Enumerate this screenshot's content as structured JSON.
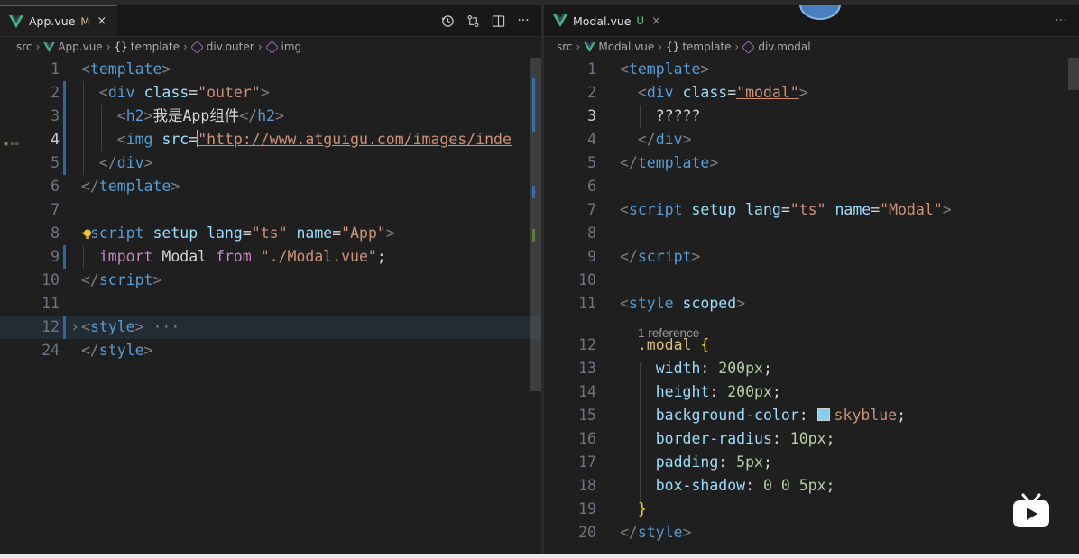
{
  "colors": {
    "vue_green": "#41b883",
    "modified": "#e2c08d",
    "untracked": "#73c991",
    "swatch_skyblue": "#87ceeb"
  },
  "left": {
    "tab": {
      "name": "App.vue",
      "status": "M",
      "close": "×",
      "icon": "vue-icon"
    },
    "actions": [
      "history-icon",
      "compare-changes-icon",
      "split-editor-icon",
      "more-actions-icon"
    ],
    "breadcrumb": {
      "root": "src",
      "file": "App.vue",
      "template": "template",
      "outer": "div.outer",
      "img": "img"
    },
    "lines": [
      {
        "n": "1",
        "tokens": [
          [
            "c-punc",
            "<"
          ],
          [
            "c-tag",
            "template"
          ],
          [
            "c-punc",
            ">"
          ]
        ]
      },
      {
        "n": "2",
        "tokens": [
          [
            "c-plain",
            "  "
          ],
          [
            "c-punc",
            "<"
          ],
          [
            "c-tag",
            "div"
          ],
          [
            "c-plain",
            " "
          ],
          [
            "c-attr",
            "class"
          ],
          [
            "c-plain",
            "="
          ],
          [
            "c-str",
            "\"outer\""
          ],
          [
            "c-punc",
            ">"
          ]
        ]
      },
      {
        "n": "3",
        "tokens": [
          [
            "c-plain",
            "    "
          ],
          [
            "c-punc",
            "<"
          ],
          [
            "c-tag",
            "h2"
          ],
          [
            "c-punc",
            ">"
          ],
          [
            "c-plain",
            "我是App组件"
          ],
          [
            "c-punc",
            "</"
          ],
          [
            "c-tag",
            "h2"
          ],
          [
            "c-punc",
            ">"
          ]
        ]
      },
      {
        "n": "4",
        "tokens": [
          [
            "c-plain",
            "    "
          ],
          [
            "c-punc",
            "<"
          ],
          [
            "c-tag",
            "img"
          ],
          [
            "c-plain",
            " "
          ],
          [
            "c-attr",
            "src"
          ],
          [
            "c-plain",
            "="
          ],
          [
            "c-cursor",
            ""
          ],
          [
            "c-str c-under",
            "\"http://www.atguigu.com/images/inde"
          ]
        ]
      },
      {
        "n": "5",
        "tokens": [
          [
            "c-plain",
            "  "
          ],
          [
            "c-punc",
            "</"
          ],
          [
            "c-tag",
            "div"
          ],
          [
            "c-punc",
            ">"
          ]
        ]
      },
      {
        "n": "6",
        "tokens": [
          [
            "c-punc",
            "</"
          ],
          [
            "c-tag",
            "template"
          ],
          [
            "c-punc",
            ">"
          ]
        ]
      },
      {
        "n": "7",
        "tokens": []
      },
      {
        "n": "8",
        "tokens": [
          [
            "c-punc",
            "<"
          ],
          [
            "c-tag",
            "script"
          ],
          [
            "c-plain",
            " "
          ],
          [
            "c-attr",
            "setup"
          ],
          [
            "c-plain",
            " "
          ],
          [
            "c-attr",
            "lang"
          ],
          [
            "c-plain",
            "="
          ],
          [
            "c-str",
            "\"ts\""
          ],
          [
            "c-plain",
            " "
          ],
          [
            "c-attr",
            "name"
          ],
          [
            "c-plain",
            "="
          ],
          [
            "c-str",
            "\"App\""
          ],
          [
            "c-punc",
            ">"
          ]
        ]
      },
      {
        "n": "9",
        "tokens": [
          [
            "c-plain",
            "  "
          ],
          [
            "c-kw",
            "import"
          ],
          [
            "c-plain",
            " Modal "
          ],
          [
            "c-kw",
            "from"
          ],
          [
            "c-plain",
            " "
          ],
          [
            "c-str",
            "\"./Modal.vue\""
          ],
          [
            "c-plain",
            ";"
          ]
        ]
      },
      {
        "n": "10",
        "tokens": [
          [
            "c-punc",
            "</"
          ],
          [
            "c-tag",
            "script"
          ],
          [
            "c-punc",
            ">"
          ]
        ]
      },
      {
        "n": "11",
        "tokens": []
      },
      {
        "n": "12",
        "tokens": [
          [
            "c-punc",
            "<"
          ],
          [
            "c-tag",
            "style"
          ],
          [
            "c-punc",
            ">"
          ],
          [
            "c-punc",
            " ···"
          ]
        ]
      },
      {
        "n": "24",
        "tokens": [
          [
            "c-punc",
            "</"
          ],
          [
            "c-tag",
            "style"
          ],
          [
            "c-punc",
            ">"
          ]
        ]
      }
    ]
  },
  "right": {
    "tab": {
      "name": "Modal.vue",
      "status": "U",
      "close": "×",
      "icon": "vue-icon"
    },
    "more": "···",
    "breadcrumb": {
      "root": "src",
      "file": "Modal.vue",
      "template": "template",
      "modal": "div.modal"
    },
    "reference": "1 reference",
    "lines": [
      {
        "n": "1",
        "tokens": [
          [
            "c-punc",
            "<"
          ],
          [
            "c-tag",
            "template"
          ],
          [
            "c-punc",
            ">"
          ]
        ]
      },
      {
        "n": "2",
        "tokens": [
          [
            "c-plain",
            "  "
          ],
          [
            "c-punc",
            "<"
          ],
          [
            "c-tag",
            "div"
          ],
          [
            "c-plain",
            " "
          ],
          [
            "c-attr",
            "class"
          ],
          [
            "c-plain",
            "="
          ],
          [
            "c-str c-under",
            "\"modal\""
          ],
          [
            "c-punc",
            ">"
          ]
        ]
      },
      {
        "n": "3",
        "tokens": [
          [
            "c-plain",
            "    ?????"
          ]
        ]
      },
      {
        "n": "4",
        "tokens": [
          [
            "c-plain",
            "  "
          ],
          [
            "c-punc",
            "</"
          ],
          [
            "c-tag",
            "div"
          ],
          [
            "c-punc",
            ">"
          ]
        ]
      },
      {
        "n": "5",
        "tokens": [
          [
            "c-punc",
            "</"
          ],
          [
            "c-tag",
            "template"
          ],
          [
            "c-punc",
            ">"
          ]
        ]
      },
      {
        "n": "6",
        "tokens": []
      },
      {
        "n": "7",
        "tokens": [
          [
            "c-punc",
            "<"
          ],
          [
            "c-tag",
            "script"
          ],
          [
            "c-plain",
            " "
          ],
          [
            "c-attr",
            "setup"
          ],
          [
            "c-plain",
            " "
          ],
          [
            "c-attr",
            "lang"
          ],
          [
            "c-plain",
            "="
          ],
          [
            "c-str",
            "\"ts\""
          ],
          [
            "c-plain",
            " "
          ],
          [
            "c-attr",
            "name"
          ],
          [
            "c-plain",
            "="
          ],
          [
            "c-str",
            "\"Modal\""
          ],
          [
            "c-punc",
            ">"
          ]
        ]
      },
      {
        "n": "8",
        "tokens": []
      },
      {
        "n": "9",
        "tokens": [
          [
            "c-punc",
            "</"
          ],
          [
            "c-tag",
            "script"
          ],
          [
            "c-punc",
            ">"
          ]
        ]
      },
      {
        "n": "10",
        "tokens": []
      },
      {
        "n": "11",
        "tokens": [
          [
            "c-punc",
            "<"
          ],
          [
            "c-tag",
            "style"
          ],
          [
            "c-plain",
            " "
          ],
          [
            "c-attr",
            "scoped"
          ],
          [
            "c-punc",
            ">"
          ]
        ]
      },
      {
        "n": "12",
        "tokens": [
          [
            "c-plain",
            "  "
          ],
          [
            "c-sel",
            ".modal"
          ],
          [
            "c-plain",
            " "
          ],
          [
            "c-brace",
            "{"
          ]
        ]
      },
      {
        "n": "13",
        "tokens": [
          [
            "c-plain",
            "    "
          ],
          [
            "c-prop",
            "width"
          ],
          [
            "c-plain",
            ": "
          ],
          [
            "c-num",
            "200px"
          ],
          [
            "c-plain",
            ";"
          ]
        ]
      },
      {
        "n": "14",
        "tokens": [
          [
            "c-plain",
            "    "
          ],
          [
            "c-prop",
            "height"
          ],
          [
            "c-plain",
            ": "
          ],
          [
            "c-num",
            "200px"
          ],
          [
            "c-plain",
            ";"
          ]
        ]
      },
      {
        "n": "15",
        "tokens": [
          [
            "c-plain",
            "    "
          ],
          [
            "c-prop",
            "background-color"
          ],
          [
            "c-plain",
            ": "
          ],
          [
            "c-swatch",
            ""
          ],
          [
            "c-str",
            "skyblue"
          ],
          [
            "c-plain",
            ";"
          ]
        ]
      },
      {
        "n": "16",
        "tokens": [
          [
            "c-plain",
            "    "
          ],
          [
            "c-prop",
            "border-radius"
          ],
          [
            "c-plain",
            ": "
          ],
          [
            "c-num",
            "10px"
          ],
          [
            "c-plain",
            ";"
          ]
        ]
      },
      {
        "n": "17",
        "tokens": [
          [
            "c-plain",
            "    "
          ],
          [
            "c-prop",
            "padding"
          ],
          [
            "c-plain",
            ": "
          ],
          [
            "c-num",
            "5px"
          ],
          [
            "c-plain",
            ";"
          ]
        ]
      },
      {
        "n": "18",
        "tokens": [
          [
            "c-plain",
            "    "
          ],
          [
            "c-prop",
            "box-shadow"
          ],
          [
            "c-plain",
            ": "
          ],
          [
            "c-num",
            "0 0 5px"
          ],
          [
            "c-plain",
            ";"
          ]
        ]
      },
      {
        "n": "19",
        "tokens": [
          [
            "c-plain",
            "  "
          ],
          [
            "c-brace",
            "}"
          ]
        ]
      },
      {
        "n": "20",
        "tokens": [
          [
            "c-punc",
            "</"
          ],
          [
            "c-tag",
            "style"
          ],
          [
            "c-punc",
            ">"
          ]
        ]
      }
    ]
  }
}
